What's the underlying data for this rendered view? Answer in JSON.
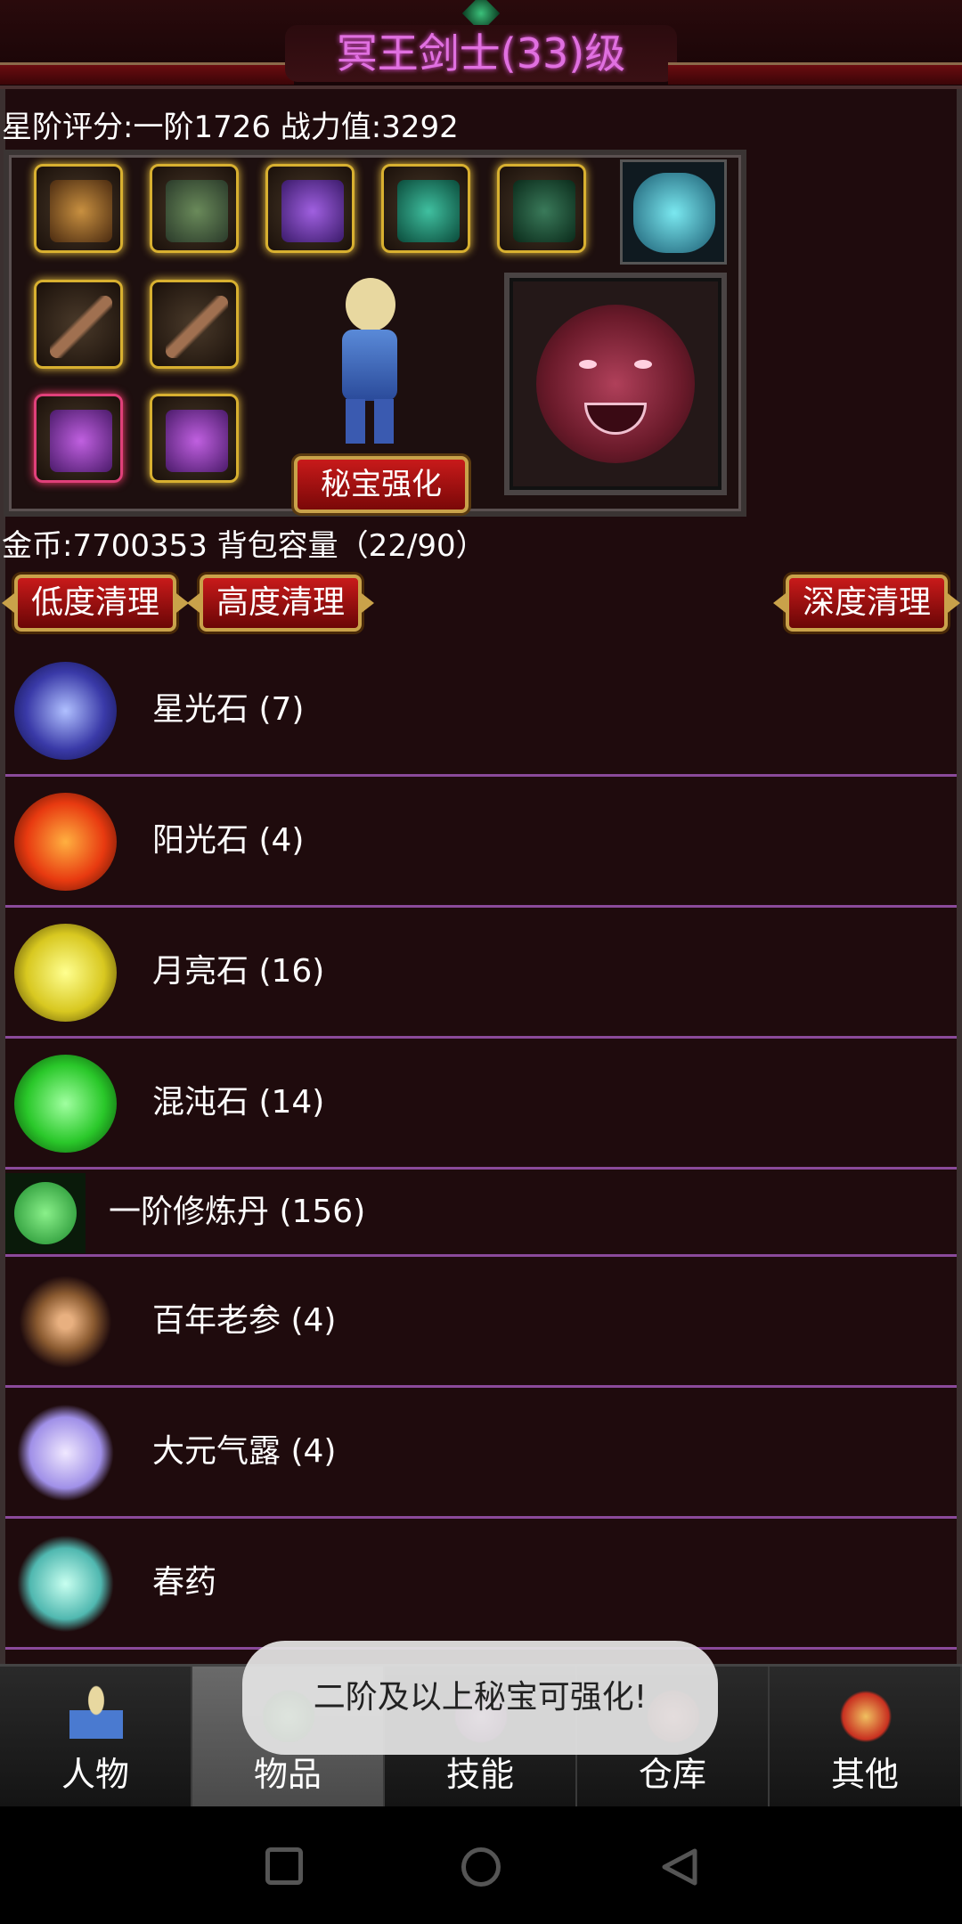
{
  "header": {
    "title": "冥王剑士(33)级"
  },
  "stats": {
    "text": "星阶评分:一阶1726 战力值:3292"
  },
  "equip": {
    "enhance_label": "秘宝强化"
  },
  "inventory": {
    "gold_text": "金币:7700353 背包容量（22/90）"
  },
  "clean_buttons": {
    "low": "低度清理",
    "high": "高度清理",
    "deep": "深度清理"
  },
  "items": [
    {
      "label": "星光石 (7)",
      "icon": "starlight-stone-icon",
      "color": "#5a6ad8"
    },
    {
      "label": "阳光石 (4)",
      "icon": "sunlight-stone-icon",
      "color": "#e84a1a"
    },
    {
      "label": "月亮石 (16)",
      "icon": "moon-stone-icon",
      "color": "#e8e030"
    },
    {
      "label": "混沌石 (14)",
      "icon": "chaos-stone-icon",
      "color": "#3ad83a"
    },
    {
      "label": "一阶修炼丹 (156)",
      "icon": "cultivation-pill-icon",
      "color": "#2aa82a"
    },
    {
      "label": "百年老参 (4)",
      "icon": "ginseng-icon",
      "color": "#c89060"
    },
    {
      "label": "大元气露 (4)",
      "icon": "elixir-bottle-icon",
      "color": "#b0a0f0"
    },
    {
      "label": "春药",
      "icon": "potion-flask-icon",
      "color": "#60c8c0"
    }
  ],
  "nav": {
    "tabs": [
      {
        "label": "人物",
        "icon": "character-tab-icon"
      },
      {
        "label": "物品",
        "icon": "items-tab-icon"
      },
      {
        "label": "技能",
        "icon": "skills-tab-icon"
      },
      {
        "label": "仓库",
        "icon": "storage-tab-icon"
      },
      {
        "label": "其他",
        "icon": "other-tab-icon"
      }
    ],
    "active": "物品"
  },
  "toast": {
    "text": "二阶及以上秘宝可强化!"
  }
}
